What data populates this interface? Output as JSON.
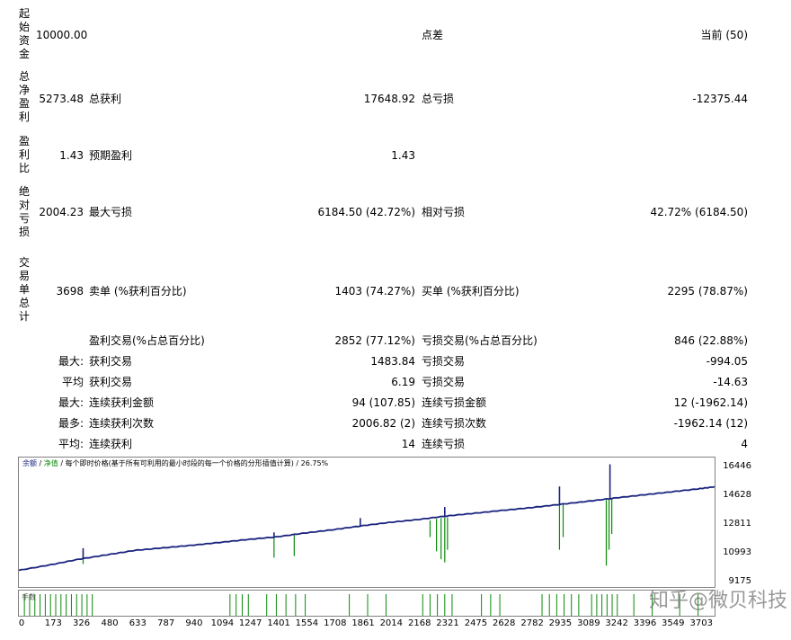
{
  "labels": {
    "initial_deposit": "起始资金",
    "total_net_profit": "总净盈利",
    "profit_factor": "盈利比",
    "absolute_drawdown": "绝对亏损",
    "total_trades": "交易单总计"
  },
  "rows": {
    "initial_deposit": {
      "value": "10000.00",
      "mid_label": "点差",
      "right_value": "当前 (50)"
    },
    "net_profit": {
      "value": "5273.48",
      "l1": "总获利",
      "v1": "17648.92",
      "l2": "总亏损",
      "v2": "-12375.44"
    },
    "profit_factor": {
      "value": "1.43",
      "l1": "预期盈利",
      "v1": "1.43"
    },
    "drawdown": {
      "value": "2004.23",
      "l1": "最大亏损",
      "v1": "6184.50 (42.72%)",
      "l2": "相对亏损",
      "v2": "42.72% (6184.50)"
    },
    "trades": {
      "value": "3698",
      "l1": "卖单 (%获利百分比)",
      "v1": "1403 (74.27%)",
      "l2": "买单 (%获利百分比)",
      "v2": "2295 (78.87%)"
    },
    "profit_trades": {
      "l1": "盈利交易(%占总百分比)",
      "v1": "2852 (77.12%)",
      "l2": "亏损交易(%占总百分比)",
      "v2": "846 (22.88%)"
    },
    "largest": {
      "prefix": "最大:",
      "l1": "获利交易",
      "v1": "1483.84",
      "l2": "亏损交易",
      "v2": "-994.05"
    },
    "average": {
      "prefix": "平均",
      "l1": "获利交易",
      "v1": "6.19",
      "l2": "亏损交易",
      "v2": "-14.63"
    },
    "max_consec": {
      "prefix": "最大:",
      "l1": "连续获利金额",
      "v1": "94 (107.85)",
      "l2": "连续亏损金额",
      "v2": "12 (-1962.14)"
    },
    "maximal": {
      "prefix": "最多:",
      "l1": "连续获利次数",
      "v1": "2006.82 (2)",
      "l2": "连续亏损次数",
      "v2": "-1962.14 (12)"
    },
    "avg_consec": {
      "prefix": "平均:",
      "l1": "连续获利",
      "v1": "14",
      "l2": "连续亏损",
      "v2": "4"
    }
  },
  "chart": {
    "legend_balance": "余额",
    "legend_equity": "净值",
    "legend_text": "每个即时价格(基于所有可利用的最小时段的每一个价格的分形插值计算)",
    "legend_pct": "26.75%",
    "volume_label": "手数",
    "watermark": "知乎@微贝科技",
    "colors": {
      "balance": "#1a237e",
      "equity": "#0a8a0a"
    }
  },
  "chart_data": {
    "type": "line",
    "yticks": [
      "16446",
      "14628",
      "12811",
      "10993",
      "9175"
    ],
    "xticks": [
      "0",
      "173",
      "326",
      "480",
      "633",
      "787",
      "940",
      "1094",
      "1247",
      "1401",
      "1554",
      "1708",
      "1861",
      "2014",
      "2168",
      "2321",
      "2475",
      "2628",
      "2782",
      "2935",
      "3089",
      "3242",
      "3396",
      "3549",
      "3703"
    ],
    "ylim": [
      9175,
      16446
    ],
    "xlim": [
      0,
      3790
    ],
    "series": [
      {
        "x": [
          0,
          173,
          326,
          480,
          633,
          787,
          940,
          1094,
          1247,
          1401,
          1554,
          1708,
          1861,
          2014,
          2168,
          2321,
          2475,
          2628,
          2782,
          2935,
          3089,
          3242,
          3396,
          3549,
          3703,
          3790
        ],
        "values": [
          10000,
          10350,
          10700,
          10980,
          11260,
          11420,
          11580,
          11760,
          11950,
          12110,
          12350,
          12560,
          12800,
          13020,
          13200,
          13420,
          13600,
          13780,
          13950,
          14150,
          14350,
          14560,
          14760,
          14950,
          15150,
          15280
        ]
      }
    ],
    "equity_drops": [
      {
        "x": 350,
        "top": 11150,
        "bottom": 10400
      },
      {
        "x": 1390,
        "top": 12100,
        "bottom": 10800
      },
      {
        "x": 1500,
        "top": 12300,
        "bottom": 10900
      },
      {
        "x": 2240,
        "top": 13150,
        "bottom": 12100
      },
      {
        "x": 2275,
        "top": 13250,
        "bottom": 11200
      },
      {
        "x": 2300,
        "top": 13300,
        "bottom": 10700
      },
      {
        "x": 2320,
        "top": 13330,
        "bottom": 10500
      },
      {
        "x": 2335,
        "top": 13350,
        "bottom": 11300
      },
      {
        "x": 2945,
        "top": 14200,
        "bottom": 11300
      },
      {
        "x": 2965,
        "top": 14220,
        "bottom": 12100
      },
      {
        "x": 3200,
        "top": 14450,
        "bottom": 10300
      },
      {
        "x": 3215,
        "top": 14470,
        "bottom": 11300
      },
      {
        "x": 3230,
        "top": 14500,
        "bottom": 12300
      }
    ],
    "balance_spikes": [
      {
        "x": 350,
        "top": 11400
      },
      {
        "x": 1390,
        "top": 12400
      },
      {
        "x": 1860,
        "top": 13300
      },
      {
        "x": 2320,
        "top": 14000
      },
      {
        "x": 2945,
        "top": 15300
      },
      {
        "x": 3220,
        "top": 16700
      }
    ]
  }
}
